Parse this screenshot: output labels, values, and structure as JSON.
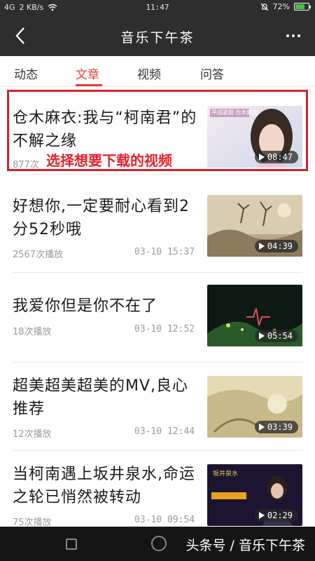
{
  "status_bar": {
    "network": "4G",
    "speed": "2 KB/s",
    "time": "11:47",
    "battery": "72%",
    "battery_level": 0.72,
    "colors": {
      "battery_fill": "#46c23a"
    }
  },
  "header": {
    "title": "音乐下午茶",
    "back_icon": "chevron-left-icon",
    "more_icon": "more-dots-icon"
  },
  "tabs": [
    {
      "label": "动态",
      "active": false
    },
    {
      "label": "文章",
      "active": true
    },
    {
      "label": "视频",
      "active": false
    },
    {
      "label": "问答",
      "active": false
    }
  ],
  "overlay_hint": "选择想要下载的视频",
  "articles": [
    {
      "title": "仓木麻衣:我与“柯南君”的不解之缘",
      "plays": "877次",
      "date": "",
      "duration": "08:47",
      "thumb_caption": "平成歌姬 仓木麻衣"
    },
    {
      "title": "好想你,一定要耐心看到2分52秒哦",
      "plays": "2567次播放",
      "date": "03-10 15:37",
      "duration": "04:39",
      "thumb_caption": ""
    },
    {
      "title": "我爱你但是你不在了",
      "plays": "18次播放",
      "date": "03-10 12:52",
      "duration": "05:54",
      "thumb_caption": ""
    },
    {
      "title": "超美超美超美的MV,良心推荐",
      "plays": "12次播放",
      "date": "03-10 12:44",
      "duration": "03:39",
      "thumb_caption": ""
    },
    {
      "title": "当柯南遇上坂井泉水,命运之轮已悄然被转动",
      "plays": "75次播放",
      "date": "03-10 09:54",
      "duration": "02:29",
      "thumb_caption": "坂井泉水"
    }
  ],
  "watermark": "头条号 / 音乐下午茶",
  "colors": {
    "accent": "#e2403a",
    "highlight_border": "#d6202c",
    "topbar": "#2e2e2e"
  }
}
